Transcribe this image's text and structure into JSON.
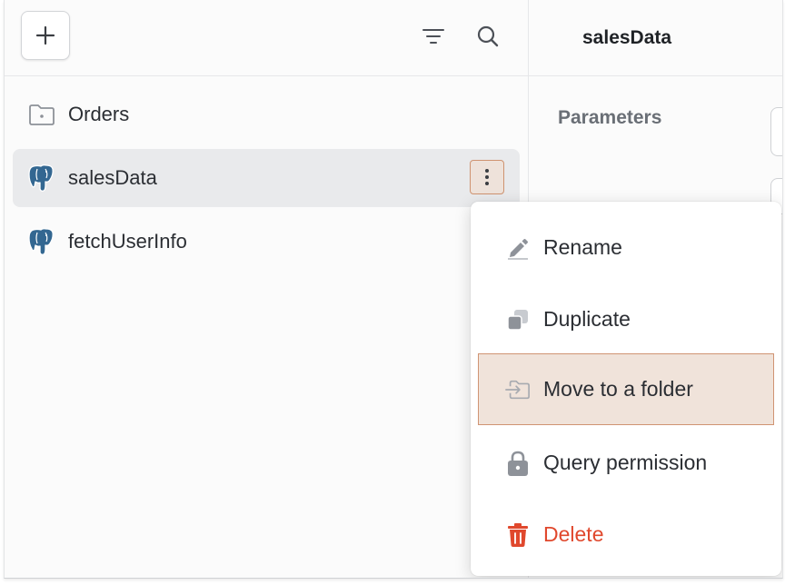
{
  "sidebar": {
    "items": [
      {
        "label": "Orders",
        "icon": "folder-icon"
      },
      {
        "label": "salesData",
        "icon": "postgres-elephant-icon",
        "selected": true
      },
      {
        "label": "fetchUserInfo",
        "icon": "postgres-elephant-icon"
      }
    ]
  },
  "detail": {
    "title": "salesData",
    "parameters_label": "Parameters"
  },
  "context_menu": {
    "items": [
      {
        "label": "Rename",
        "icon": "pencil-icon"
      },
      {
        "label": "Duplicate",
        "icon": "duplicate-icon"
      },
      {
        "label": "Move to a folder",
        "icon": "move-to-folder-icon",
        "hovered": true
      },
      {
        "label": "Query permission",
        "icon": "lock-icon"
      },
      {
        "label": "Delete",
        "icon": "trash-icon",
        "danger": true
      }
    ]
  },
  "colors": {
    "selected_row": "#e9eaec",
    "hover_fill": "#f0e3da",
    "hover_border": "#d09473",
    "danger": "#e0482d",
    "postgres_blue": "#336791"
  }
}
